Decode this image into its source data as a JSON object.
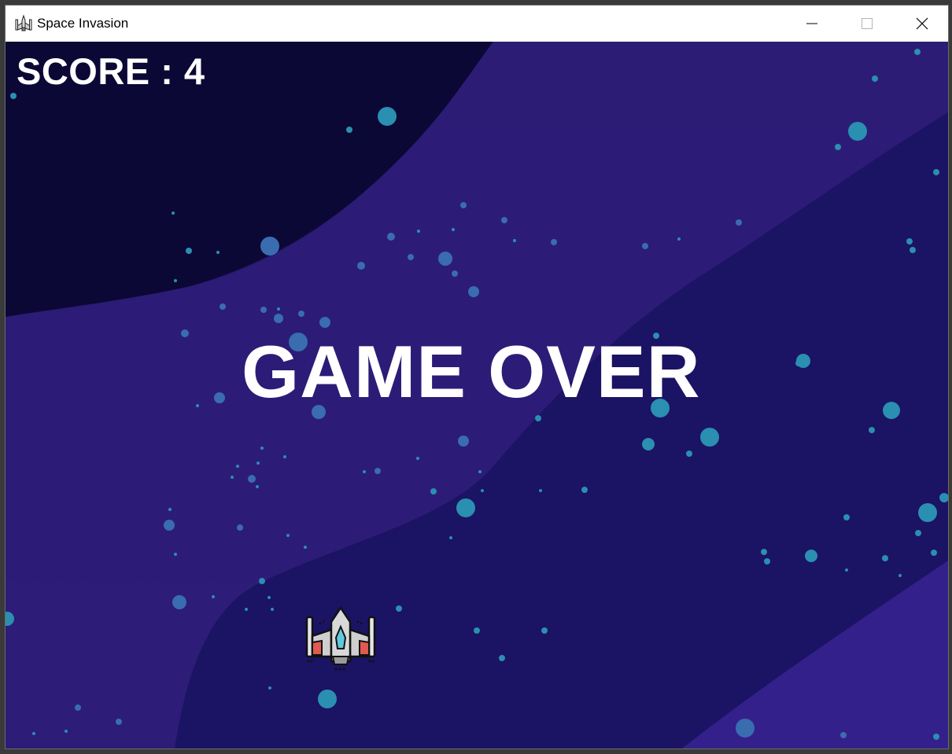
{
  "window": {
    "title": "Space Invasion",
    "icon": "spaceship-icon",
    "controls": [
      "minimize-icon",
      "maximize-icon",
      "close-icon"
    ]
  },
  "game": {
    "score_text": "SCORE : 4",
    "score": 4,
    "status_text": "GAME OVER",
    "player": "player-spaceship-icon"
  },
  "colors": {
    "bg_dark": "#0c0a3a",
    "bg_mid": "#1f1460",
    "bg_band": "#2f1d7a",
    "star": "#2a8fb0",
    "text": "#ffffff"
  }
}
